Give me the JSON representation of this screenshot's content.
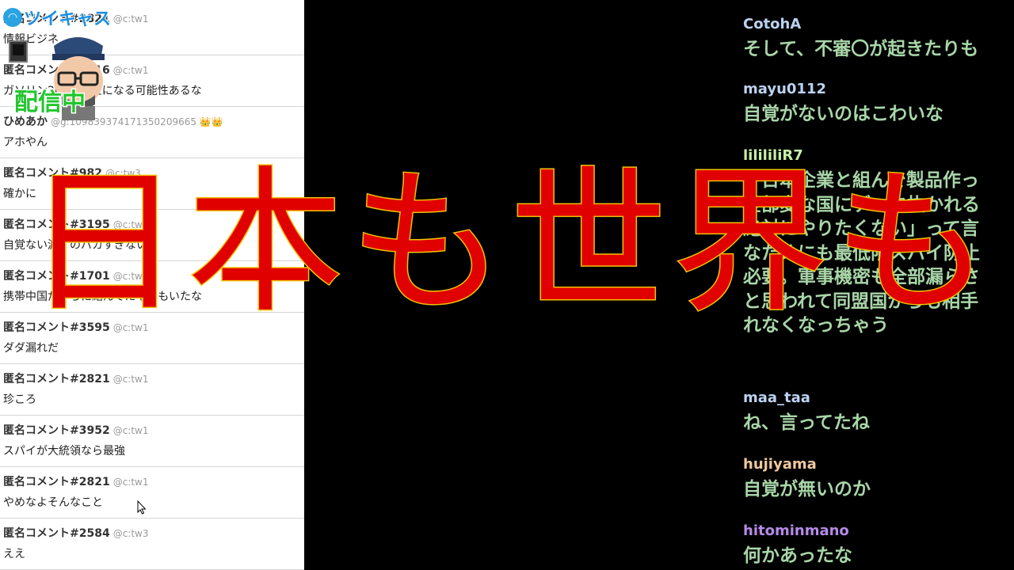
{
  "logo": {
    "text": "ツイキャス",
    "mark": "◠"
  },
  "live_badge": "配信中",
  "left_comments": [
    {
      "name": "匿名コメント#2821",
      "source": "@c:tw1",
      "text": "情報ビジネ"
    },
    {
      "name": "匿名コメント#2616",
      "source": "@c:tw1",
      "text": "ガソリン200円以上になる可能性あるな"
    },
    {
      "name": "ひめあか",
      "source": "@g:109839374171350209665 👑👑",
      "text": "アホやん"
    },
    {
      "name": "匿名コメント#982",
      "source": "@c:tw3",
      "text": "確かに"
    },
    {
      "name": "匿名コメント#3195",
      "source": "@c:tw2",
      "text": "自覚ない渡すのバカすぎない？"
    },
    {
      "name": "匿名コメント#1701",
      "source": "@c:tw2",
      "text": "携帯中国だからに絡んでたやつもいたな"
    },
    {
      "name": "匿名コメント#3595",
      "source": "@c:tw1",
      "text": "ダダ漏れだ"
    },
    {
      "name": "匿名コメント#2821",
      "source": "@c:tw1",
      "text": "珍ころ"
    },
    {
      "name": "匿名コメント#3952",
      "source": "@c:tw1",
      "text": "スパイが大統領なら最強"
    },
    {
      "name": "匿名コメント#2821",
      "source": "@c:tw1",
      "text": "やめなよそんなこと"
    },
    {
      "name": "匿名コメント#2584",
      "source": "@c:tw3",
      "text": "ええ"
    }
  ],
  "right_comments": [
    {
      "name": "CotohA",
      "color": "#bcd2f2",
      "lines": [
        "そして、不審〇が起きたりも"
      ]
    },
    {
      "name": "mayu0112",
      "color": "#bcd2f2",
      "lines": [
        "自覚がないのはこわいな"
      ]
    },
    {
      "name": "lilililiR7",
      "color": "#c6f0a6",
      "lines": [
        "「日本企業と組んで製品作っ",
        "全部変な国にデータ抜かれる",
        "絶対にやりたくない」って言",
        "なためにも最低限スパイ防止",
        "必要。軍事機密も全部漏らさ",
        "と思われて同盟国からも相手",
        "れなくなっちゃう"
      ]
    },
    {
      "name": "maa_taa",
      "color": "#bcd2f2",
      "lines": [
        "ね、言ってたね"
      ]
    },
    {
      "name": "hujiyama",
      "color": "#f0c8a0",
      "lines": [
        "自覚が無いのか"
      ]
    },
    {
      "name": "hitominmano",
      "color": "#b68be8",
      "lines": [
        "何かあったな"
      ]
    }
  ],
  "overlay_caption": "日本も世界も"
}
